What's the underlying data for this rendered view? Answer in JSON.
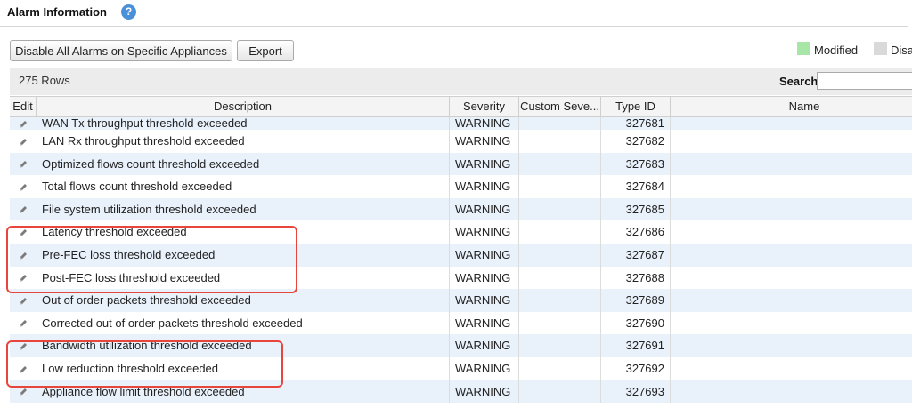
{
  "header": {
    "title": "Alarm Information",
    "help_icon": "?"
  },
  "toolbar": {
    "disable_label": "Disable All Alarms on Specific Appliances",
    "export_label": "Export"
  },
  "legend": {
    "modified_label": "Modified",
    "modified_color": "#a8e6a8",
    "disabled_label": "Disa",
    "disabled_color": "#d9d9d9"
  },
  "grid": {
    "row_count": "275 Rows",
    "search_label": "Search",
    "search_value": "",
    "columns": [
      "Edit",
      "Description",
      "Severity",
      "Custom Seve...",
      "Type ID",
      "Name"
    ],
    "rows": [
      {
        "description": "WAN Tx throughput threshold exceeded",
        "severity": "WARNING",
        "custom": "",
        "type_id": "327681",
        "name": ""
      },
      {
        "description": "LAN Rx throughput threshold exceeded",
        "severity": "WARNING",
        "custom": "",
        "type_id": "327682",
        "name": ""
      },
      {
        "description": "Optimized flows count threshold exceeded",
        "severity": "WARNING",
        "custom": "",
        "type_id": "327683",
        "name": ""
      },
      {
        "description": "Total flows count threshold exceeded",
        "severity": "WARNING",
        "custom": "",
        "type_id": "327684",
        "name": ""
      },
      {
        "description": "File system utilization threshold exceeded",
        "severity": "WARNING",
        "custom": "",
        "type_id": "327685",
        "name": ""
      },
      {
        "description": "Latency threshold exceeded",
        "severity": "WARNING",
        "custom": "",
        "type_id": "327686",
        "name": ""
      },
      {
        "description": "Pre-FEC loss threshold exceeded",
        "severity": "WARNING",
        "custom": "",
        "type_id": "327687",
        "name": ""
      },
      {
        "description": "Post-FEC loss threshold exceeded",
        "severity": "WARNING",
        "custom": "",
        "type_id": "327688",
        "name": ""
      },
      {
        "description": "Out of order packets threshold exceeded",
        "severity": "WARNING",
        "custom": "",
        "type_id": "327689",
        "name": ""
      },
      {
        "description": "Corrected out of order packets threshold exceeded",
        "severity": "WARNING",
        "custom": "",
        "type_id": "327690",
        "name": ""
      },
      {
        "description": "Bandwidth utilization threshold exceeded",
        "severity": "WARNING",
        "custom": "",
        "type_id": "327691",
        "name": ""
      },
      {
        "description": "Low reduction threshold exceeded",
        "severity": "WARNING",
        "custom": "",
        "type_id": "327692",
        "name": ""
      },
      {
        "description": "Appliance flow limit threshold exceeded",
        "severity": "WARNING",
        "custom": "",
        "type_id": "327693",
        "name": ""
      }
    ]
  },
  "icons": {
    "edit": "pencil-icon",
    "help": "help-icon"
  },
  "colors": {
    "row_alt": "#e9f1fb",
    "highlight": "#e8453c",
    "accent": "#4a90d9"
  }
}
